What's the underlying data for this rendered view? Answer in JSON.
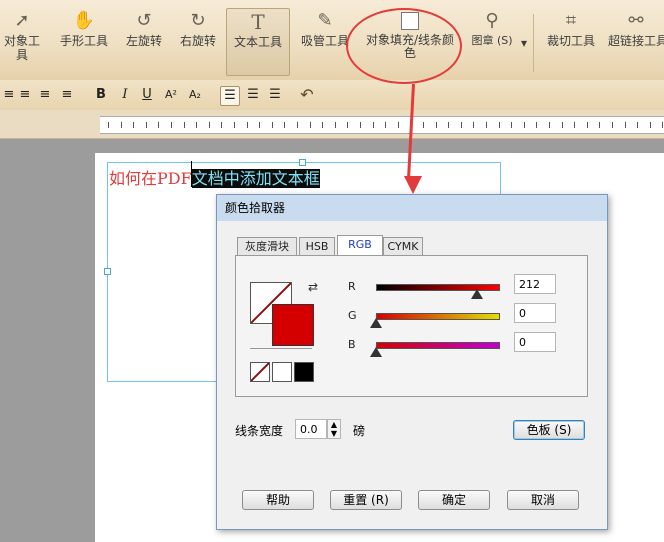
{
  "toolbar": {
    "tools": [
      {
        "label": "对象工具",
        "icon": "arrow-pointer-icon"
      },
      {
        "label": "手形工具",
        "icon": "hand-icon"
      },
      {
        "label": "左旋转",
        "icon": "rotate-left-icon"
      },
      {
        "label": "右旋转",
        "icon": "rotate-right-icon"
      },
      {
        "label": "文本工具",
        "icon": "text-T-icon"
      },
      {
        "label": "吸管工具",
        "icon": "eyedropper-icon"
      },
      {
        "label": "对象填充/线条颜色",
        "icon": "fill-color-swatch-icon"
      },
      {
        "label": "图章 (S)",
        "icon": "stamp-icon"
      },
      {
        "label": "裁切工具",
        "icon": "crop-icon"
      },
      {
        "label": "超链接工具",
        "icon": "link-icon"
      }
    ],
    "dropdown_glyph": "▾"
  },
  "format_toolbar": {
    "bold": "B",
    "italic": "I",
    "underline": "U",
    "superscript": "A²",
    "subscript": "A₂",
    "undo_glyph": "↶"
  },
  "document": {
    "text_plain": "如何在PDF",
    "text_selected": "文档中添加文本框"
  },
  "dialog": {
    "title": "颜色拾取器",
    "tabs": [
      "灰度滑块",
      "HSB",
      "RGB",
      "CYMK"
    ],
    "active_tab": "RGB",
    "sliders": [
      {
        "label": "R",
        "value": "212",
        "level": 0.83
      },
      {
        "label": "G",
        "value": "0",
        "level": 0
      },
      {
        "label": "B",
        "value": "0",
        "level": 0
      }
    ],
    "current_color": "#d40000",
    "line_width_label": "线条宽度",
    "line_width_value": "0.0",
    "line_width_unit": "磅",
    "palette_button": "色板 (S)",
    "buttons": {
      "help": "帮助",
      "reset": "重置 (R)",
      "ok": "确定",
      "cancel": "取消"
    }
  },
  "colors": {
    "accent_red": "#e23b3b",
    "selection_bg": "#0c0c0c",
    "selection_text": "#7fe3f3"
  }
}
